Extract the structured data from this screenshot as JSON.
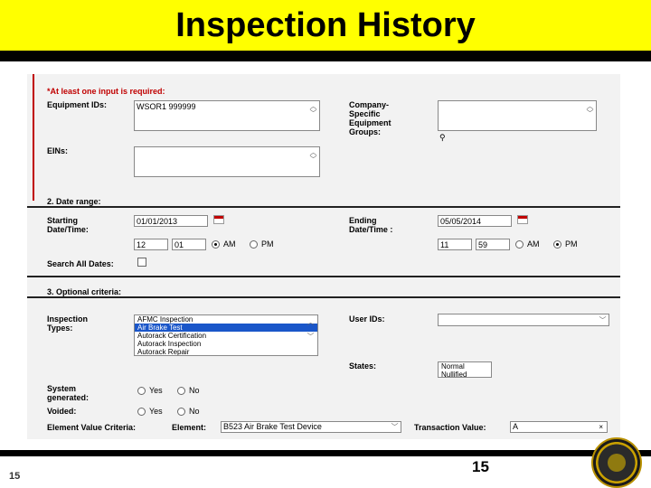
{
  "slide": {
    "title": "Inspection History",
    "page_left": "15",
    "page_center": "15"
  },
  "section1": {
    "required_note": "*At least one input is required:",
    "equipment_ids_label": "Equipment IDs:",
    "equipment_ids_value": "WSOR1  999999",
    "company_groups_label": "Company-\nSpecific\nEquipment\nGroups:",
    "eins_label": "EINs:"
  },
  "section2": {
    "heading": "2. Date range:",
    "starting_label": "Starting\nDate/Time:",
    "start_date": "01/01/2013",
    "start_hour": "12",
    "start_min": "01",
    "ending_label": "Ending\nDate/Time :",
    "end_date": "05/05/2014",
    "end_hour": "11",
    "end_min": "59",
    "am": "AM",
    "pm": "PM",
    "search_all_label": "Search All Dates:"
  },
  "section3": {
    "heading": "3. Optional criteria:",
    "inspection_types_label": "Inspection\nTypes:",
    "inspection_types": [
      "AFMC Inspection",
      "Air Brake Test",
      "Autorack Certification",
      "Autorack Inspection",
      "Autorack Repair"
    ],
    "selected_type": "Air Brake Test",
    "user_ids_label": "User IDs:",
    "states_label": "States:",
    "states": [
      "Normal",
      "Nullified"
    ],
    "system_generated_label": "System\ngenerated:",
    "voided_label": "Voided:",
    "yes": "Yes",
    "no": "No",
    "element_value_label": "Element Value Criteria:",
    "element_label": "Element:",
    "element_value": "B523   Air Brake Test Device",
    "transaction_label": "Transaction Value:",
    "transaction_value": "A"
  }
}
